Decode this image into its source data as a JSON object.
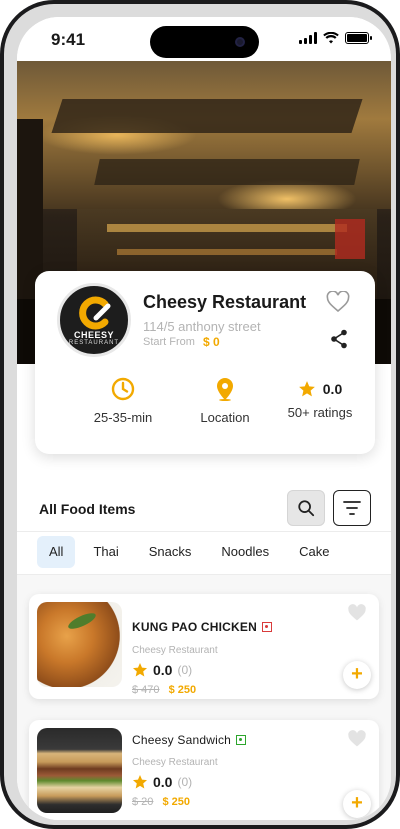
{
  "status_bar": {
    "time": "9:41"
  },
  "restaurant": {
    "name": "Cheesy Restaurant",
    "address": "114/5 anthony street",
    "start_label": "Start From",
    "start_price": "$ 0",
    "logo_text_1": "CHEESY",
    "logo_text_2": "RESTAURANT"
  },
  "stats": {
    "time": "25-35-min",
    "location": "Location",
    "rating_value": "0.0",
    "rating_count": "50+ ratings"
  },
  "section": {
    "title": "All Food Items"
  },
  "tabs": [
    {
      "label": "All",
      "active": true
    },
    {
      "label": "Thai"
    },
    {
      "label": "Snacks"
    },
    {
      "label": "Noodles"
    },
    {
      "label": "Cake"
    }
  ],
  "foods": [
    {
      "name": "KUNG PAO CHICKEN",
      "type": "non-veg",
      "restaurant": "Cheesy Restaurant",
      "rating": "0.0",
      "rating_count": "(0)",
      "old_price": "$ 470",
      "new_price": "$ 250"
    },
    {
      "name": "Cheesy Sandwich",
      "type": "veg",
      "restaurant": "Cheesy Restaurant",
      "rating": "0.0",
      "rating_count": "(0)",
      "old_price": "$ 20",
      "new_price": "$ 250"
    }
  ],
  "colors": {
    "accent": "#f2a900",
    "tab_active_bg": "#e4f0fb",
    "muted_text": "#b3b3b3",
    "non_veg": "#d93b3b",
    "veg": "#2ca52c"
  }
}
